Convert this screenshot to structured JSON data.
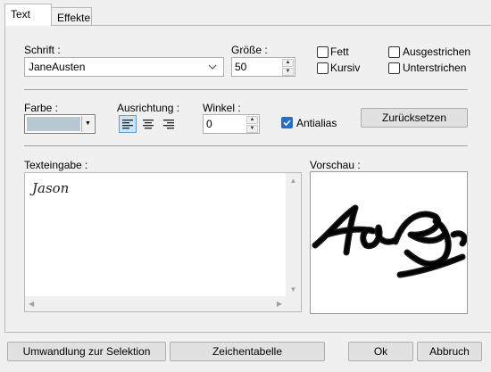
{
  "tabs": [
    {
      "label": "Text",
      "active": true
    },
    {
      "label": "Effekte",
      "active": false
    }
  ],
  "font": {
    "label": "Schrift :",
    "value": "JaneAusten"
  },
  "size": {
    "label": "Größe :",
    "value": "50"
  },
  "style_checks": {
    "bold": {
      "label": "Fett",
      "checked": false
    },
    "italic": {
      "label": "Kursiv",
      "checked": false
    },
    "strikeout": {
      "label": "Ausgestrichen",
      "checked": false
    },
    "underline": {
      "label": "Unterstrichen",
      "checked": false
    }
  },
  "color": {
    "label": "Farbe :",
    "swatch": "#b8c8d2"
  },
  "alignment": {
    "label": "Ausrichtung :",
    "options": [
      "left",
      "center",
      "right"
    ],
    "selected": "left"
  },
  "angle": {
    "label": "Winkel :",
    "value": "0"
  },
  "antialias": {
    "label": "Antialias",
    "checked": true
  },
  "reset_label": "Zurücksetzen",
  "text_input": {
    "label": "Texteingabe :",
    "value": "Jason"
  },
  "preview": {
    "label": "Vorschau :"
  },
  "buttons": {
    "convert": "Umwandlung zur Selektion",
    "charmap": "Zeichentabelle",
    "ok": "Ok",
    "cancel": "Abbruch"
  },
  "colors": {
    "accent": "#1f6fd0",
    "selected_bg": "#cce4f7"
  }
}
